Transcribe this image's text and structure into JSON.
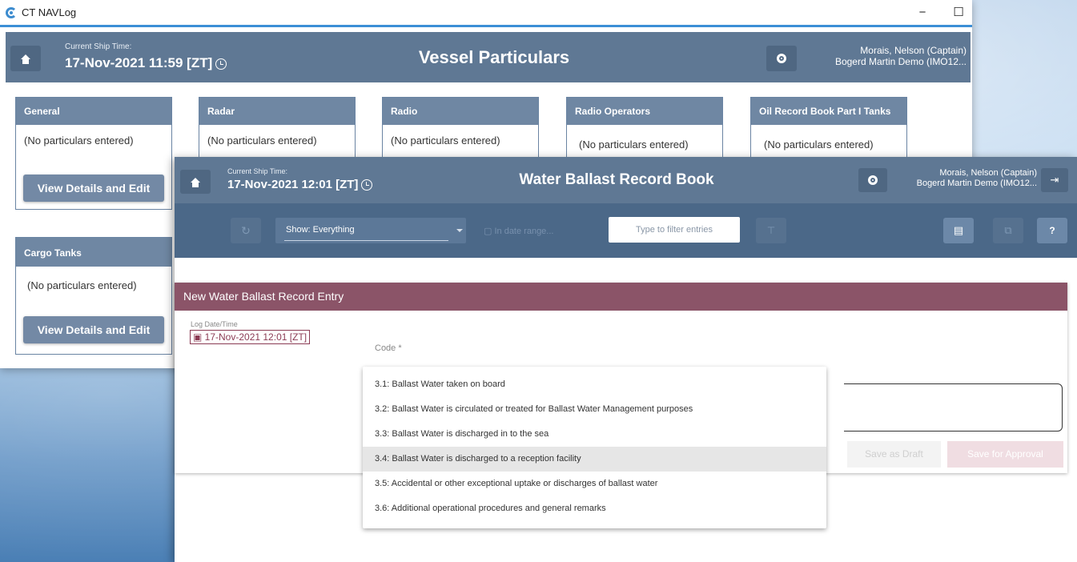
{
  "app": {
    "window_title": "CT NAVLog"
  },
  "back_window": {
    "time_label": "Current Ship Time:",
    "time_value": "17-Nov-2021 11:59 [ZT]",
    "page_title": "Vessel Particulars",
    "user_line1": "Morais, Nelson (Captain)",
    "user_line2": "Bogerd Martin Demo (IMO12...",
    "cards": [
      {
        "title": "General",
        "body": "(No particulars entered)",
        "button": "View Details and Edit"
      },
      {
        "title": "Radar",
        "body": "(No particulars entered)"
      },
      {
        "title": "Radio",
        "body": "(No particulars entered)"
      },
      {
        "title": "Radio Operators",
        "body": "(No particulars entered)"
      },
      {
        "title": "Oil Record Book Part I Tanks",
        "body": "(No particulars entered)"
      },
      {
        "title": "Cargo Tanks",
        "body": "(No particulars entered)",
        "button": "View Details and Edit"
      }
    ]
  },
  "front_window": {
    "time_label": "Current Ship Time:",
    "time_value": "17-Nov-2021 12:01 [ZT]",
    "page_title": "Water Ballast Record Book",
    "user_line1": "Morais, Nelson (Captain)",
    "user_line2": "Bogerd Martin Demo (IMO12...",
    "toolbar": {
      "show_label": "Show: Everything",
      "date_range": "In date range...",
      "filter_placeholder": "Type to filter entries"
    },
    "entry": {
      "header": "New Water Ballast Record Entry",
      "log_label": "Log Date/Time",
      "log_value": "17-Nov-2021 12:01 [ZT]",
      "code_label": "Code *",
      "save_draft": "Save as Draft",
      "save_approval": "Save for Approval"
    },
    "code_options": [
      "3.1: Ballast Water taken on board",
      "3.2: Ballast Water is circulated or treated for Ballast Water Management purposes",
      "3.3: Ballast Water is discharged in to the sea",
      "3.4: Ballast Water is discharged to a reception facility",
      "3.5: Accidental or other exceptional uptake or discharges of ballast water",
      "3.6: Additional operational procedures and general remarks"
    ],
    "highlighted_option_index": 3
  },
  "colors": {
    "header_bg": "#5f7894",
    "toolbar_bg": "#4b6888",
    "entry_header_bg": "#8b5468",
    "accent": "#3c8fd6"
  }
}
